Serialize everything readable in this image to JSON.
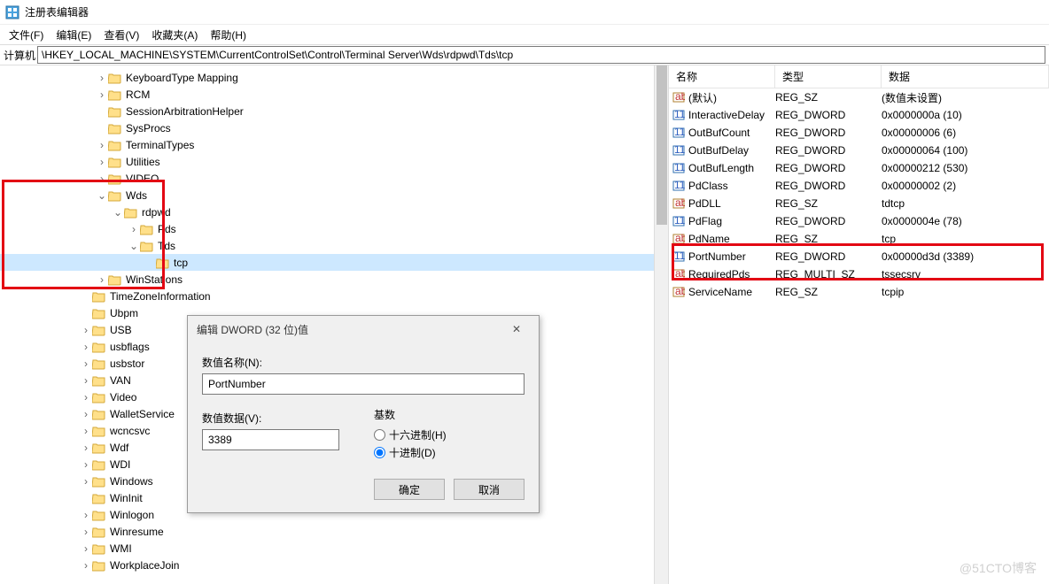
{
  "window": {
    "title": "注册表编辑器"
  },
  "menu": {
    "file": "文件(F)",
    "edit": "编辑(E)",
    "view": "查看(V)",
    "fav": "收藏夹(A)",
    "help": "帮助(H)"
  },
  "address": {
    "label": "计算机",
    "path": "\\HKEY_LOCAL_MACHINE\\SYSTEM\\CurrentControlSet\\Control\\Terminal Server\\Wds\\rdpwd\\Tds\\tcp"
  },
  "tree": [
    {
      "l": "KeyboardType Mapping",
      "d": 6,
      "t": ">"
    },
    {
      "l": "RCM",
      "d": 6,
      "t": ">"
    },
    {
      "l": "SessionArbitrationHelper",
      "d": 6,
      "t": ""
    },
    {
      "l": "SysProcs",
      "d": 6,
      "t": ""
    },
    {
      "l": "TerminalTypes",
      "d": 6,
      "t": ">"
    },
    {
      "l": "Utilities",
      "d": 6,
      "t": ">"
    },
    {
      "l": "VIDEO",
      "d": 6,
      "t": ">"
    },
    {
      "l": "Wds",
      "d": 6,
      "t": "v"
    },
    {
      "l": "rdpwd",
      "d": 7,
      "t": "v"
    },
    {
      "l": "Pds",
      "d": 8,
      "t": ">"
    },
    {
      "l": "Tds",
      "d": 8,
      "t": "v"
    },
    {
      "l": "tcp",
      "d": 9,
      "t": "",
      "sel": true
    },
    {
      "l": "WinStations",
      "d": 6,
      "t": ">"
    },
    {
      "l": "TimeZoneInformation",
      "d": 5,
      "t": ""
    },
    {
      "l": "Ubpm",
      "d": 5,
      "t": ""
    },
    {
      "l": "USB",
      "d": 5,
      "t": ">"
    },
    {
      "l": "usbflags",
      "d": 5,
      "t": ">"
    },
    {
      "l": "usbstor",
      "d": 5,
      "t": ">"
    },
    {
      "l": "VAN",
      "d": 5,
      "t": ">"
    },
    {
      "l": "Video",
      "d": 5,
      "t": ">"
    },
    {
      "l": "WalletService",
      "d": 5,
      "t": ">"
    },
    {
      "l": "wcncsvc",
      "d": 5,
      "t": ">"
    },
    {
      "l": "Wdf",
      "d": 5,
      "t": ">"
    },
    {
      "l": "WDI",
      "d": 5,
      "t": ">"
    },
    {
      "l": "Windows",
      "d": 5,
      "t": ">"
    },
    {
      "l": "WinInit",
      "d": 5,
      "t": ""
    },
    {
      "l": "Winlogon",
      "d": 5,
      "t": ">"
    },
    {
      "l": "Winresume",
      "d": 5,
      "t": ">"
    },
    {
      "l": "WMI",
      "d": 5,
      "t": ">"
    },
    {
      "l": "WorkplaceJoin",
      "d": 5,
      "t": ">"
    }
  ],
  "list": {
    "headers": {
      "name": "名称",
      "type": "类型",
      "data": "数据"
    },
    "rows": [
      {
        "ic": "sz",
        "n": "(默认)",
        "t": "REG_SZ",
        "d": "(数值未设置)"
      },
      {
        "ic": "dw",
        "n": "InteractiveDelay",
        "t": "REG_DWORD",
        "d": "0x0000000a (10)"
      },
      {
        "ic": "dw",
        "n": "OutBufCount",
        "t": "REG_DWORD",
        "d": "0x00000006 (6)"
      },
      {
        "ic": "dw",
        "n": "OutBufDelay",
        "t": "REG_DWORD",
        "d": "0x00000064 (100)"
      },
      {
        "ic": "dw",
        "n": "OutBufLength",
        "t": "REG_DWORD",
        "d": "0x00000212 (530)"
      },
      {
        "ic": "dw",
        "n": "PdClass",
        "t": "REG_DWORD",
        "d": "0x00000002 (2)"
      },
      {
        "ic": "sz",
        "n": "PdDLL",
        "t": "REG_SZ",
        "d": "tdtcp"
      },
      {
        "ic": "dw",
        "n": "PdFlag",
        "t": "REG_DWORD",
        "d": "0x0000004e (78)"
      },
      {
        "ic": "sz",
        "n": "PdName",
        "t": "REG_SZ",
        "d": "tcp"
      },
      {
        "ic": "dw",
        "n": "PortNumber",
        "t": "REG_DWORD",
        "d": "0x00000d3d (3389)"
      },
      {
        "ic": "sz",
        "n": "RequiredPds",
        "t": "REG_MULTI_SZ",
        "d": "tssecsrv"
      },
      {
        "ic": "sz",
        "n": "ServiceName",
        "t": "REG_SZ",
        "d": "tcpip"
      }
    ]
  },
  "dialog": {
    "title": "编辑 DWORD (32 位)值",
    "name_label": "数值名称(N):",
    "name_value": "PortNumber",
    "data_label": "数值数据(V):",
    "data_value": "3389",
    "base_label": "基数",
    "radix_hex": "十六进制(H)",
    "radix_dec": "十进制(D)",
    "ok": "确定",
    "cancel": "取消"
  },
  "watermark": "@51CTO博客"
}
